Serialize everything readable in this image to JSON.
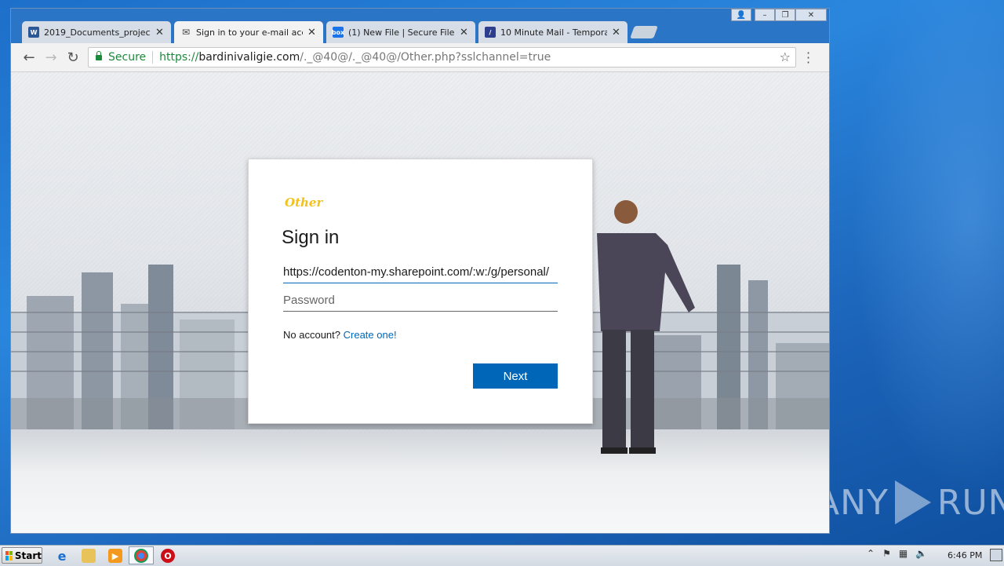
{
  "browser": {
    "tabs": [
      {
        "title": "2019_Documents_project_n",
        "icon": "word-doc-icon",
        "active": false
      },
      {
        "title": "Sign in to your e-mail accoun",
        "icon": "mail-icon",
        "active": true
      },
      {
        "title": "(1) New File | Secure File Sh",
        "icon": "box-icon",
        "active": false
      },
      {
        "title": "10 Minute Mail - Temporary",
        "icon": "tenminutemail-icon",
        "active": false
      }
    ],
    "omnibox": {
      "secure_label": "Secure",
      "url_scheme": "https://",
      "url_host": "bardinivaligie.com",
      "url_path": "/._@40@/._@40@/Other.php?sslchannel=true"
    }
  },
  "signin": {
    "brand": "Other",
    "title": "Sign in",
    "email_value": "https://codenton-my.sharepoint.com/:w:/g/personal/",
    "password_placeholder": "Password",
    "no_account_text": "No account?",
    "create_link": "Create one!",
    "next_label": "Next"
  },
  "taskbar": {
    "start_label": "Start",
    "clock": "6:46 PM"
  },
  "watermark": {
    "left": "ANY",
    "right": "RUN"
  },
  "colors": {
    "accent": "#0067b8",
    "secure": "#1c8a3b",
    "brand": "#f2c21a"
  }
}
